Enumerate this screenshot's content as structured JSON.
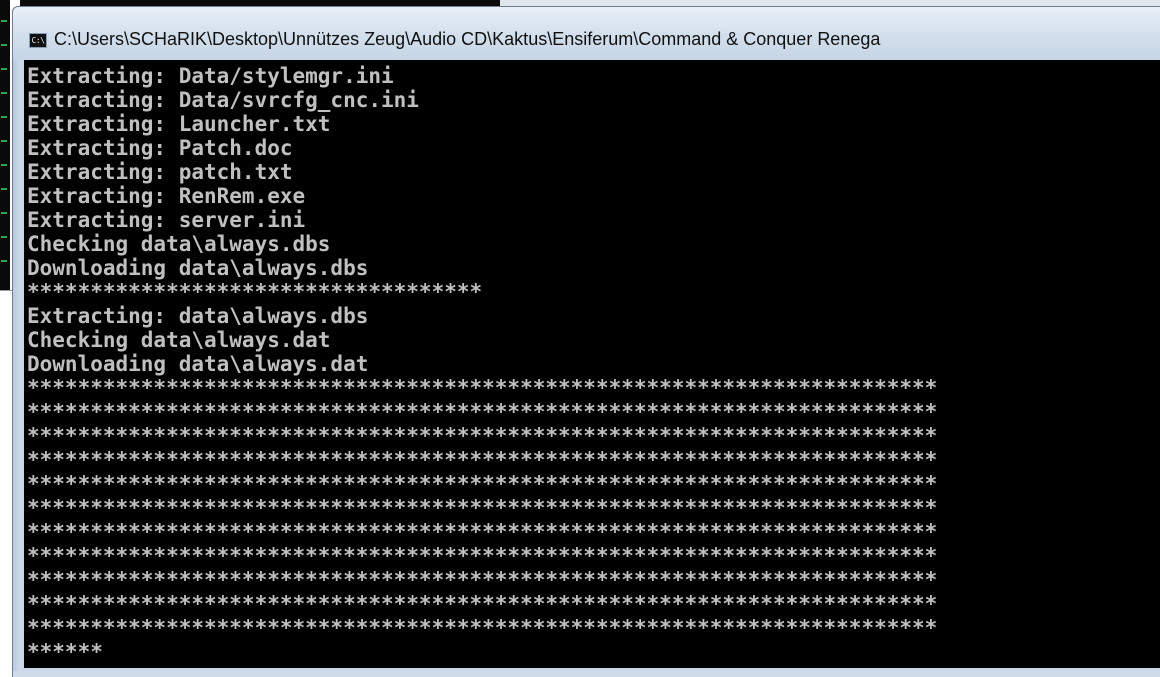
{
  "window": {
    "icon_label": "C:\\",
    "title": "C:\\Users\\SCHaRIK\\Desktop\\Unnützes Zeug\\Audio CD\\Kaktus\\Ensiferum\\Command & Conquer Renega"
  },
  "console": {
    "lines": [
      "Extracting: Data/stylemgr.ini",
      "Extracting: Data/svrcfg_cnc.ini",
      "Extracting: Launcher.txt",
      "Extracting: Patch.doc",
      "Extracting: patch.txt",
      "Extracting: RenRem.exe",
      "Extracting: server.ini",
      "Checking data\\always.dbs",
      "Downloading data\\always.dbs",
      "************************************",
      "Extracting: data\\always.dbs",
      "Checking data\\always.dat",
      "Downloading data\\always.dat",
      "************************************************************************",
      "************************************************************************",
      "************************************************************************",
      "************************************************************************",
      "************************************************************************",
      "************************************************************************",
      "************************************************************************",
      "************************************************************************",
      "************************************************************************",
      "************************************************************************",
      "************************************************************************",
      "******"
    ]
  },
  "colors": {
    "console_bg": "#000000",
    "console_text": "#c0c0c0",
    "titlebar": "#d2dfec"
  }
}
